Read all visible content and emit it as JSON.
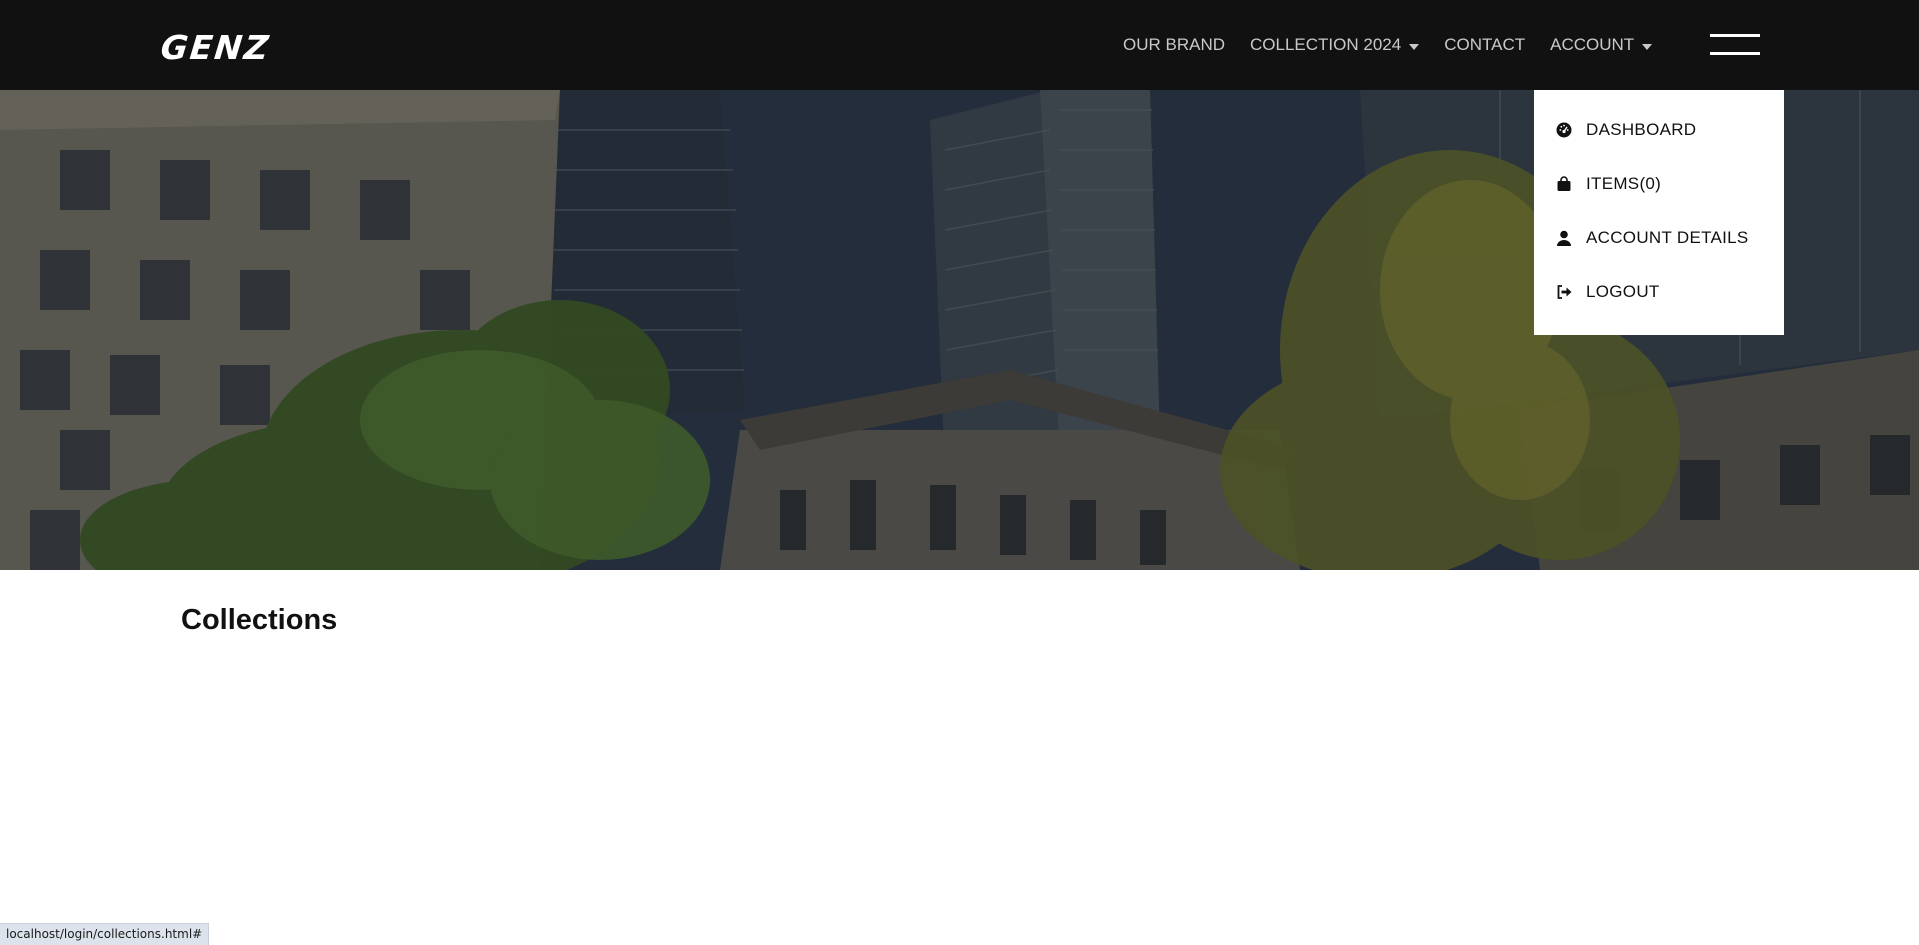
{
  "header": {
    "logo": "GENZ",
    "nav": [
      {
        "label": "OUR BRAND",
        "dropdown": false
      },
      {
        "label": "COLLECTION 2024",
        "dropdown": true
      },
      {
        "label": "CONTACT",
        "dropdown": false
      },
      {
        "label": "ACCOUNT",
        "dropdown": true
      }
    ]
  },
  "account_menu": {
    "items": [
      {
        "label": "DASHBOARD",
        "icon": "dashboard-icon"
      },
      {
        "label": "ITEMS(0)",
        "icon": "bag-icon"
      },
      {
        "label": "ACCOUNT DETAILS",
        "icon": "user-icon"
      },
      {
        "label": "LOGOUT",
        "icon": "logout-icon"
      }
    ]
  },
  "main": {
    "title": "Collections"
  },
  "status_url": "localhost/login/collections.html#",
  "colors": {
    "header_bg": "#111111",
    "nav_text": "#c9c9c9",
    "menu_bg": "#ffffff"
  }
}
